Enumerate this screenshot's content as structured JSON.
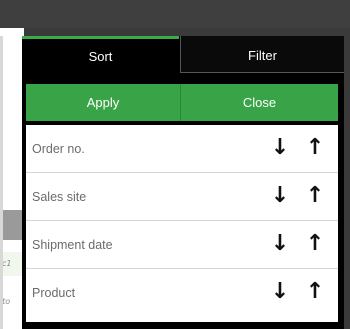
{
  "background": {
    "row1_text": "c1",
    "row2_text": "sto"
  },
  "tabs": [
    {
      "label": "Sort",
      "active": true
    },
    {
      "label": "Filter",
      "active": false
    }
  ],
  "actions": {
    "apply_label": "Apply",
    "close_label": "Close"
  },
  "sort_fields": [
    {
      "label": "Order no.",
      "desc_icon": "↓",
      "asc_icon": "↑"
    },
    {
      "label": "Sales site",
      "desc_icon": "↓",
      "asc_icon": "↑"
    },
    {
      "label": "Shipment date",
      "desc_icon": "↓",
      "asc_icon": "↑"
    },
    {
      "label": "Product",
      "desc_icon": "↓",
      "asc_icon": "↑"
    }
  ],
  "colors": {
    "accent": "#39a447",
    "panel": "#000000",
    "text_muted": "#6b6b6b"
  }
}
